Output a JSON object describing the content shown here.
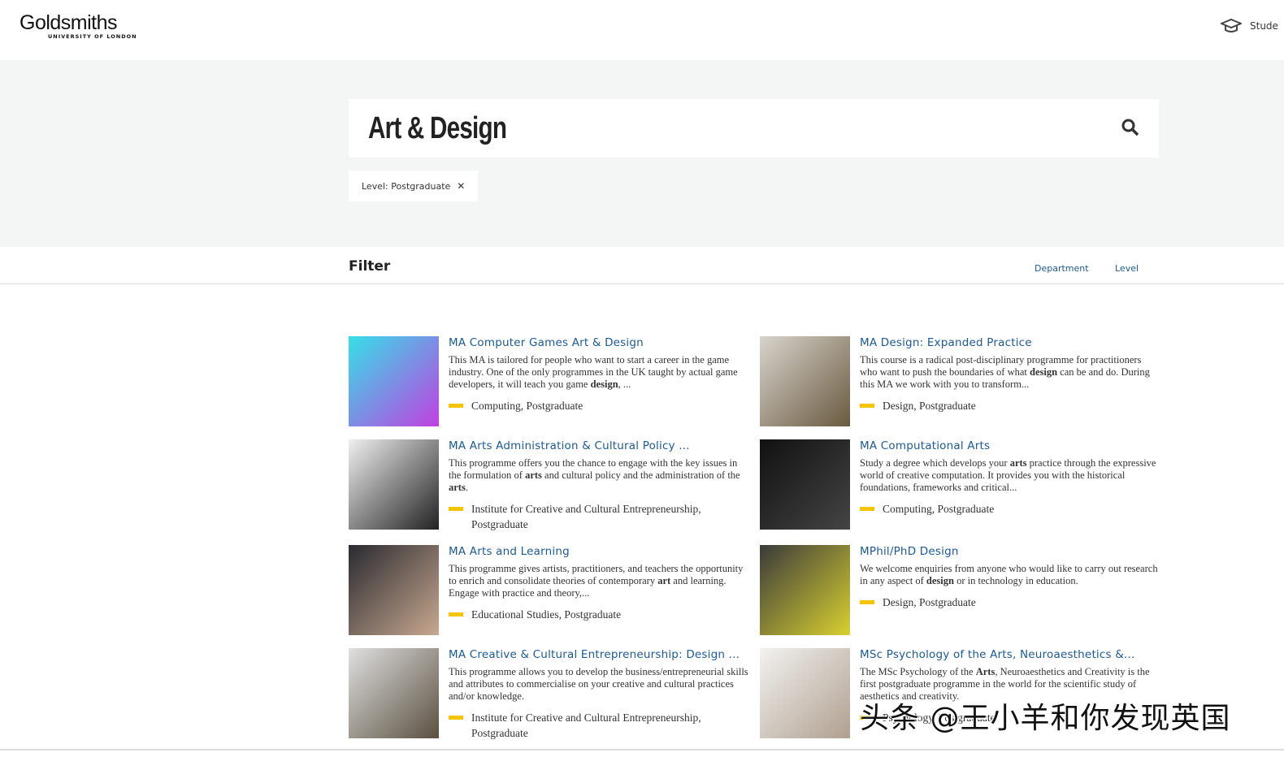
{
  "header": {
    "logo_name": "Goldsmiths",
    "logo_sub": "UNIVERSITY OF LONDON",
    "student_label": "Stude",
    "student_icon": "graduation-cap-icon"
  },
  "search": {
    "value": "Art & Design",
    "icon": "search-icon"
  },
  "active_filter": {
    "label": "Level: Postgraduate",
    "remove": "✕"
  },
  "filter": {
    "title": "Filter",
    "links": [
      "Department",
      "Level"
    ]
  },
  "colors": {
    "link": "#1a5a96",
    "tag_bar": "#f5c400",
    "hero_bg": "#f4f5f5"
  },
  "courses": [
    {
      "title": "MA Computer Games Art & Design",
      "desc": [
        [
          "This MA is tailored for people who want to start a career in the game industry. One of the only programmes in the UK taught by actual game developers, it will teach you game ",
          0
        ],
        [
          "design",
          1
        ],
        [
          ", ...",
          0
        ]
      ],
      "tags": "Computing, Postgraduate",
      "img": [
        "#35e0e8",
        "#c040e0"
      ]
    },
    {
      "title": "MA Design: Expanded Practice",
      "desc": [
        [
          "This course is a radical post-disciplinary programme for practitioners who want to push the boundaries of what ",
          0
        ],
        [
          "design",
          1
        ],
        [
          " can be and do. During this MA we work with you to transform...",
          0
        ]
      ],
      "tags": "Design, Postgraduate",
      "img": [
        "#d8d4cc",
        "#6a5a40"
      ]
    },
    {
      "title": "MA Arts Administration & Cultural Policy ...",
      "desc": [
        [
          "This programme offers you the chance to engage with the key issues in the formulation of ",
          0
        ],
        [
          "arts",
          1
        ],
        [
          " and cultural policy and the administration of the ",
          0
        ],
        [
          "arts",
          1
        ],
        [
          ".",
          0
        ]
      ],
      "tags": "Institute for Creative and Cultural Entrepreneurship, Postgraduate",
      "img": [
        "#f0f0f0",
        "#222"
      ]
    },
    {
      "title": "MA Computational Arts",
      "desc": [
        [
          "Study a degree which develops your ",
          0
        ],
        [
          "arts",
          1
        ],
        [
          " practice through the expressive world of creative computation. It provides you with the historical foundations, frameworks and critical...",
          0
        ]
      ],
      "tags": "Computing, Postgraduate",
      "img": [
        "#111",
        "#444"
      ]
    },
    {
      "title": "MA Arts and Learning",
      "desc": [
        [
          "This programme gives artists, practitioners, and teachers the opportunity to enrich and consolidate theories of contemporary ",
          0
        ],
        [
          "art",
          1
        ],
        [
          " and learning. Engage with practice and theory,...",
          0
        ]
      ],
      "tags": "Educational Studies, Postgraduate",
      "img": [
        "#2a2a30",
        "#c8a890"
      ]
    },
    {
      "title": "MPhil/PhD Design",
      "desc": [
        [
          "We welcome enquiries from anyone who would like to carry out research in any aspect of ",
          0
        ],
        [
          "design",
          1
        ],
        [
          " or in technology in education.",
          0
        ]
      ],
      "tags": "Design, Postgraduate",
      "img": [
        "#3a3a3a",
        "#d8d030"
      ]
    },
    {
      "title": "MA Creative & Cultural Entrepreneurship: Design ...",
      "desc": [
        [
          "This programme allows you to develop the business/entrepreneurial skills and attributes to commercialise on your creative and cultural practices and/or knowledge.",
          0
        ]
      ],
      "tags": "Institute for Creative and Cultural Entrepreneurship, Postgraduate",
      "img": [
        "#e0e0e0",
        "#5a5040"
      ]
    },
    {
      "title": "MSc Psychology of the Arts, Neuroaesthetics &...",
      "desc": [
        [
          "The MSc Psychology of the ",
          0
        ],
        [
          "Arts",
          1
        ],
        [
          ", Neuroaesthetics and Creativity is the first postgraduate programme in the world for the scientific study of aesthetics and creativity.",
          0
        ]
      ],
      "tags": "Psychology, Postgraduate",
      "img": [
        "#f2f2f0",
        "#b0a090"
      ]
    }
  ],
  "watermark": "头条 @王小羊和你发现英国"
}
